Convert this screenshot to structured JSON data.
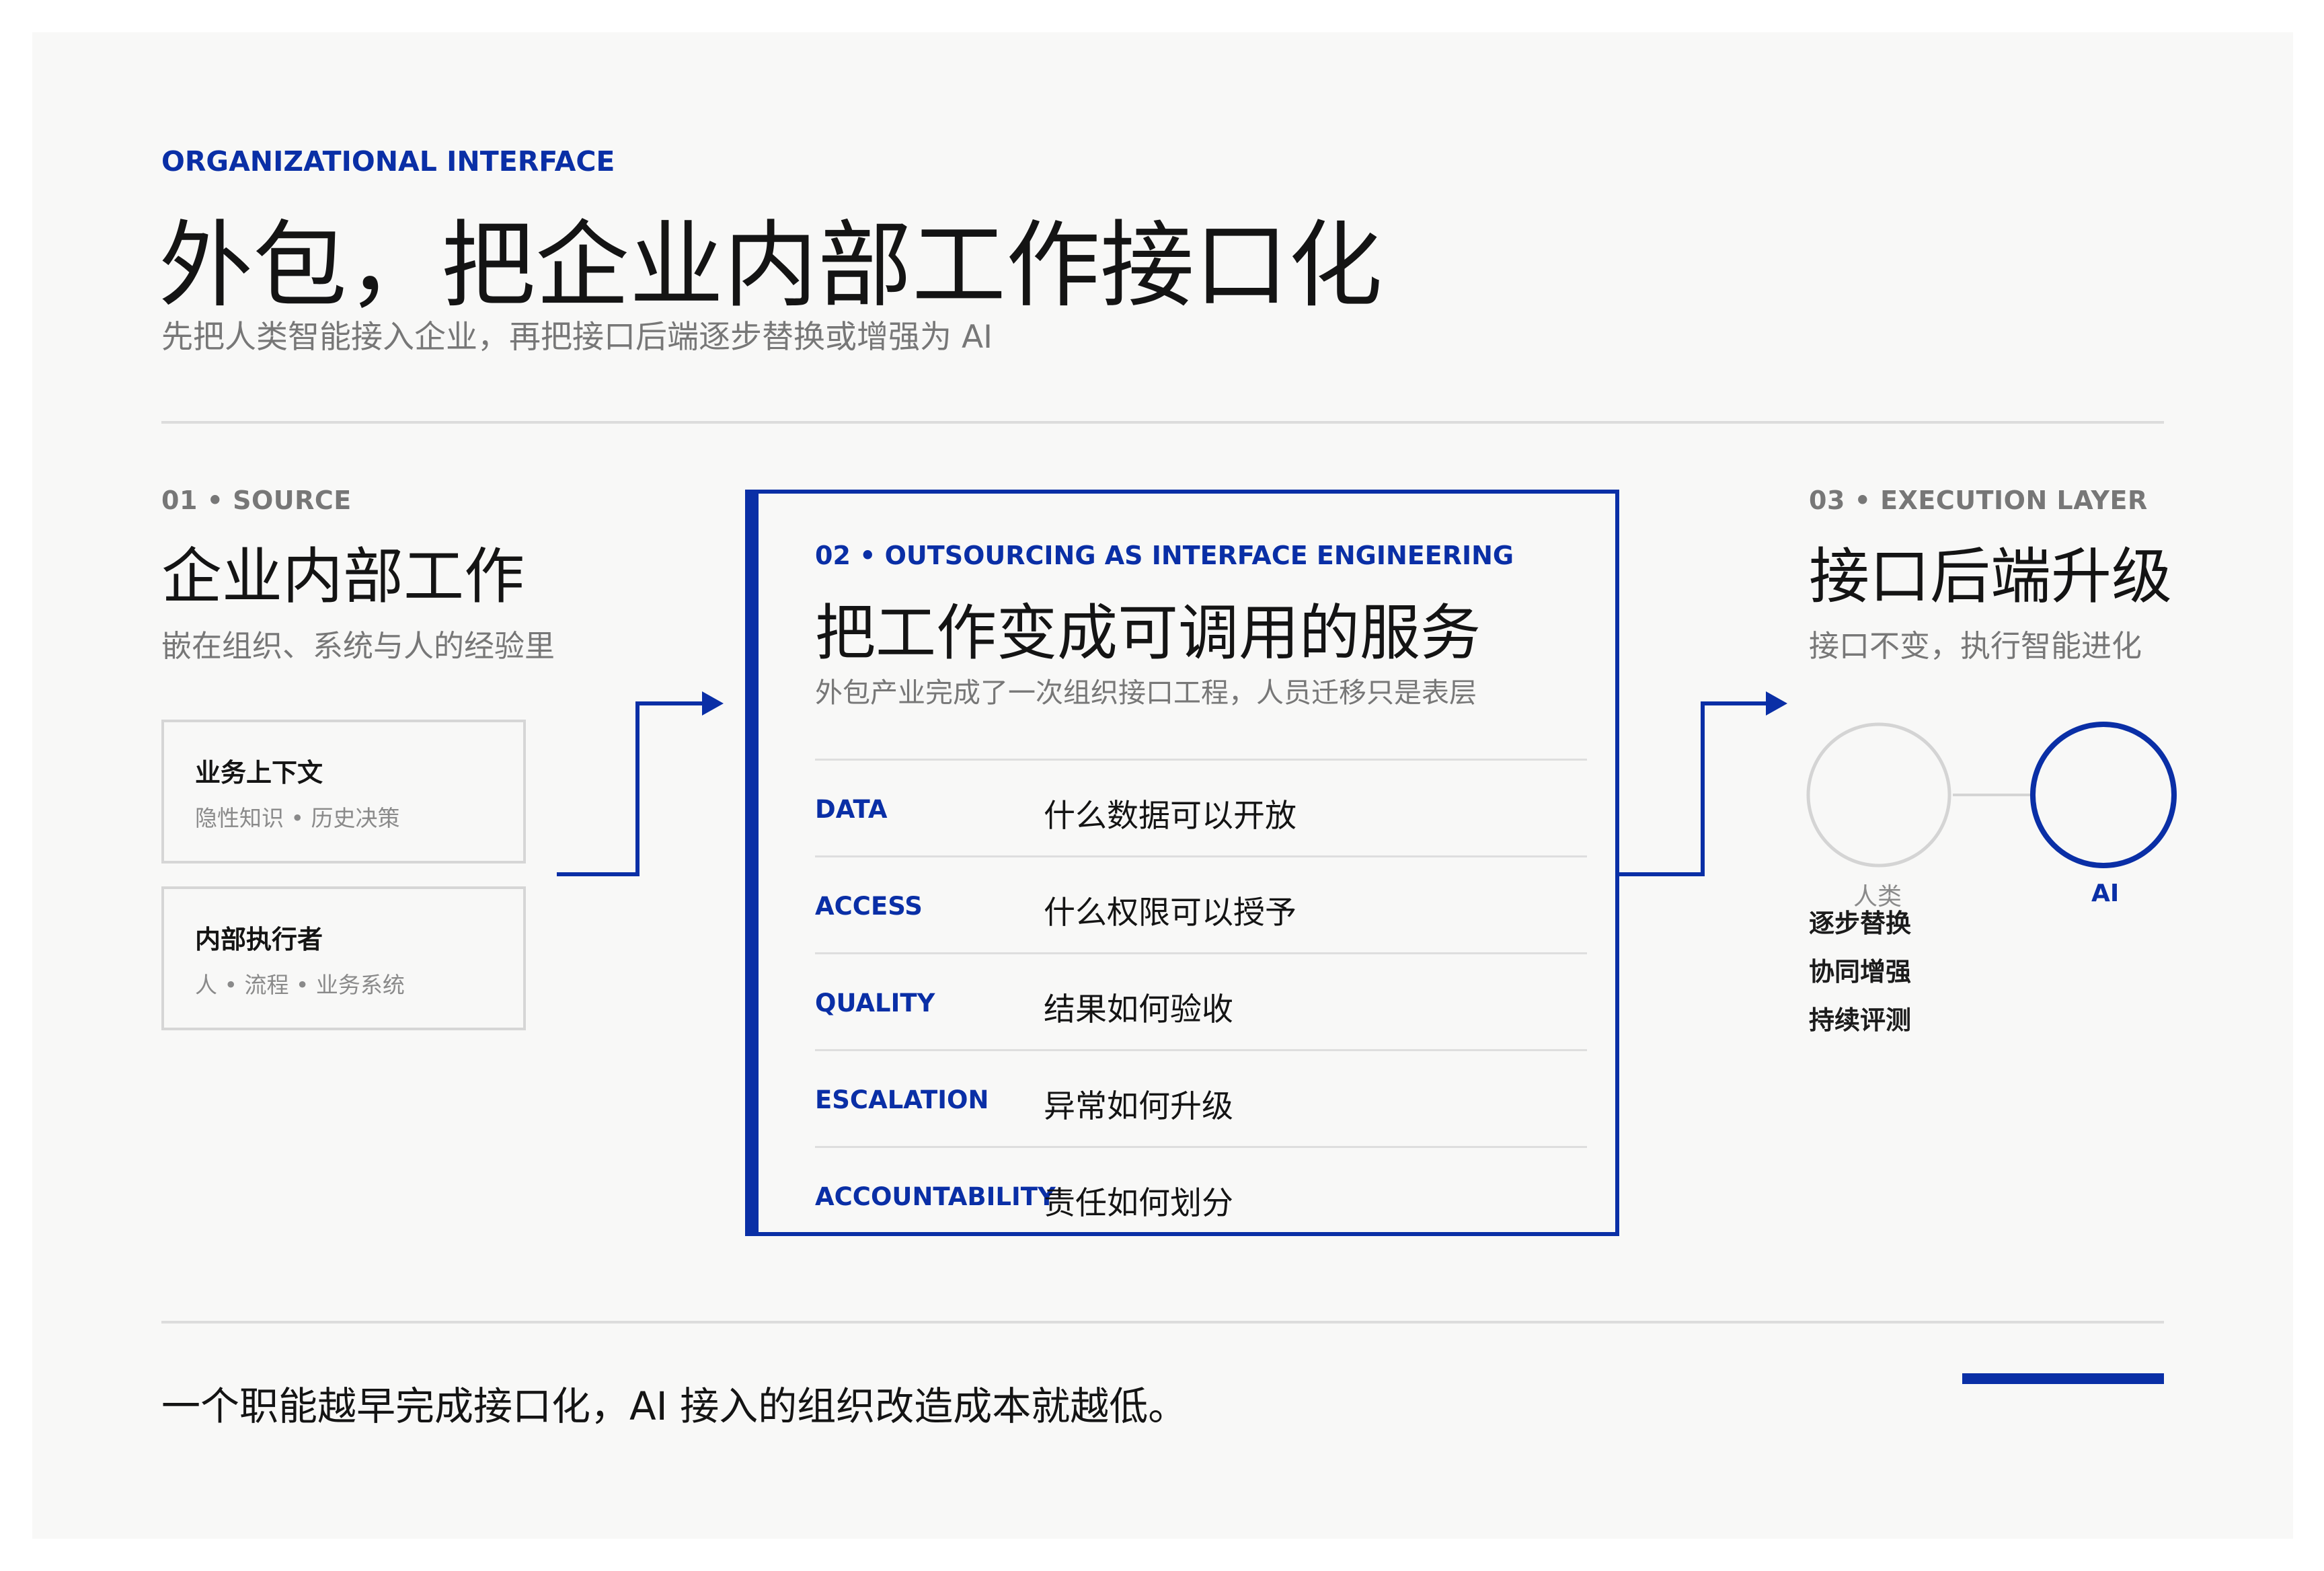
{
  "header": {
    "eyebrow": "ORGANIZATIONAL INTERFACE",
    "title": "外包，把企业内部工作接口化",
    "subtitle": "先把人类智能接入企业，再把接口后端逐步替换或增强为 AI"
  },
  "source": {
    "step": "01 • SOURCE",
    "title": "企业内部工作",
    "subtitle": "嵌在组织、系统与人的经验里",
    "cards": [
      {
        "title": "业务上下文",
        "sub": "隐性知识 • 历史决策"
      },
      {
        "title": "内部执行者",
        "sub": "人 • 流程 • 业务系统"
      }
    ]
  },
  "interface": {
    "step": "02 • OUTSOURCING AS INTERFACE ENGINEERING",
    "title": "把工作变成可调用的服务",
    "subtitle": "外包产业完成了一次组织接口工程，人员迁移只是表层",
    "rows": [
      {
        "key": "DATA",
        "value": "什么数据可以开放"
      },
      {
        "key": "ACCESS",
        "value": "什么权限可以授予"
      },
      {
        "key": "QUALITY",
        "value": "结果如何验收"
      },
      {
        "key": "ESCALATION",
        "value": "异常如何升级"
      },
      {
        "key": "ACCOUNTABILITY",
        "value": "责任如何划分"
      }
    ]
  },
  "execution": {
    "step": "03 • EXECUTION LAYER",
    "title": "接口后端升级",
    "subtitle": "接口不变，执行智能进化",
    "human_label": "人类",
    "ai_label": "AI",
    "tags": [
      "逐步替换",
      "协同增强",
      "持续评测"
    ]
  },
  "footer": {
    "text": "一个职能越早完成接口化，AI 接入的组织改造成本就越低。"
  },
  "colors": {
    "accent": "#0a2fa6",
    "rule": "#dcdcdc",
    "muted_text": "#777777",
    "background": "#f8f8f7"
  }
}
